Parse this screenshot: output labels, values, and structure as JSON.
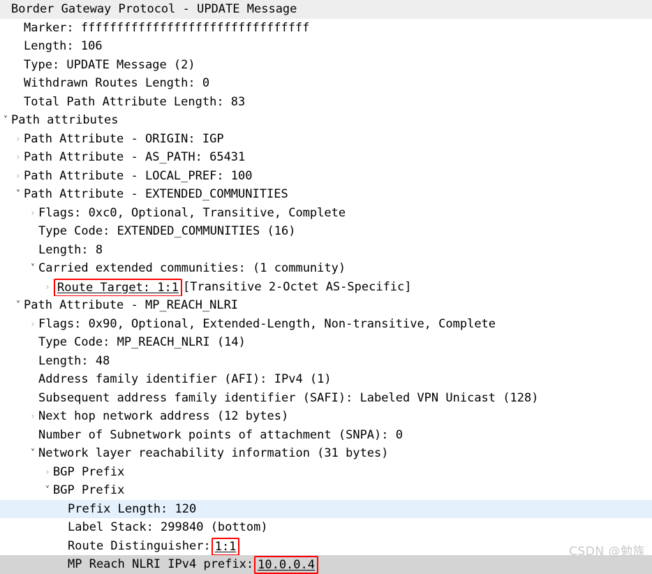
{
  "watermark": "CSDN @勉族",
  "colors": {
    "annotation_box": "#ff0000",
    "selected_row": "#e4f0fb",
    "focused_row": "#d4d4d4",
    "title_row": "#eeeeee",
    "text": "#000000",
    "chevron_collapsed": "#b4b4b4",
    "chevron_expanded": "#2b2b2b"
  },
  "icons": {
    "expanded": "˅",
    "collapsed": "›"
  },
  "tree": [
    {
      "id": "bgp-update-message",
      "indent": 0,
      "toggle": "none",
      "bg": "title",
      "text": "Border Gateway Protocol - UPDATE Message"
    },
    {
      "id": "marker",
      "indent": 1,
      "toggle": "none",
      "bg": "none",
      "text": "Marker: ffffffffffffffffffffffffffffffff"
    },
    {
      "id": "length",
      "indent": 1,
      "toggle": "none",
      "bg": "none",
      "text": "Length: 106"
    },
    {
      "id": "type",
      "indent": 1,
      "toggle": "none",
      "bg": "none",
      "text": "Type: UPDATE Message (2)"
    },
    {
      "id": "withdrawn-routes-length",
      "indent": 1,
      "toggle": "none",
      "bg": "none",
      "text": "Withdrawn Routes Length: 0"
    },
    {
      "id": "total-path-attribute-length",
      "indent": 1,
      "toggle": "none",
      "bg": "none",
      "text": "Total Path Attribute Length: 83"
    },
    {
      "id": "path-attributes",
      "indent": 0,
      "toggle": "expanded",
      "bg": "none",
      "text": "Path attributes"
    },
    {
      "id": "path-attribute-origin",
      "indent": 1,
      "toggle": "collapsed",
      "bg": "none",
      "text": "Path Attribute - ORIGIN: IGP"
    },
    {
      "id": "path-attribute-as-path",
      "indent": 1,
      "toggle": "collapsed",
      "bg": "none",
      "text": "Path Attribute - AS_PATH: 65431"
    },
    {
      "id": "path-attribute-local-pref",
      "indent": 1,
      "toggle": "collapsed",
      "bg": "none",
      "text": "Path Attribute - LOCAL_PREF: 100"
    },
    {
      "id": "path-attribute-extended-communities",
      "indent": 1,
      "toggle": "expanded",
      "bg": "none",
      "text": "Path Attribute - EXTENDED_COMMUNITIES"
    },
    {
      "id": "ext-comm-flags",
      "indent": 2,
      "toggle": "collapsed",
      "bg": "none",
      "text": "Flags: 0xc0, Optional, Transitive, Complete"
    },
    {
      "id": "ext-comm-type-code",
      "indent": 2,
      "toggle": "none",
      "bg": "none",
      "text": "Type Code: EXTENDED_COMMUNITIES (16)"
    },
    {
      "id": "ext-comm-length",
      "indent": 2,
      "toggle": "none",
      "bg": "none",
      "text": "Length: 8"
    },
    {
      "id": "carried-extended-communities",
      "indent": 2,
      "toggle": "expanded",
      "bg": "none",
      "text": "Carried extended communities: (1 community)"
    },
    {
      "id": "route-target",
      "indent": 3,
      "toggle": "collapsed",
      "bg": "none",
      "parts": [
        {
          "style": "boxed-underline",
          "text": "Route Target: 1:1"
        },
        {
          "style": "plain",
          "text": " [Transitive 2-Octet AS-Specific]"
        }
      ]
    },
    {
      "id": "path-attribute-mp-reach-nlri",
      "indent": 1,
      "toggle": "expanded",
      "bg": "none",
      "text": "Path Attribute - MP_REACH_NLRI"
    },
    {
      "id": "mp-reach-flags",
      "indent": 2,
      "toggle": "collapsed",
      "bg": "none",
      "text": "Flags: 0x90, Optional, Extended-Length, Non-transitive, Complete"
    },
    {
      "id": "mp-reach-type-code",
      "indent": 2,
      "toggle": "none",
      "bg": "none",
      "text": "Type Code: MP_REACH_NLRI (14)"
    },
    {
      "id": "mp-reach-length",
      "indent": 2,
      "toggle": "none",
      "bg": "none",
      "text": "Length: 48"
    },
    {
      "id": "address-family-identifier",
      "indent": 2,
      "toggle": "none",
      "bg": "none",
      "text": "Address family identifier (AFI): IPv4 (1)"
    },
    {
      "id": "subsequent-address-family-identifier",
      "indent": 2,
      "toggle": "none",
      "bg": "none",
      "text": "Subsequent address family identifier (SAFI): Labeled VPN Unicast (128)"
    },
    {
      "id": "next-hop-network-address",
      "indent": 2,
      "toggle": "collapsed",
      "bg": "none",
      "text": "Next hop network address (12 bytes)"
    },
    {
      "id": "number-of-snpa",
      "indent": 2,
      "toggle": "none",
      "bg": "none",
      "text": "Number of Subnetwork points of attachment (SNPA): 0"
    },
    {
      "id": "network-layer-reachability-information",
      "indent": 2,
      "toggle": "expanded",
      "bg": "none",
      "text": "Network layer reachability information (31 bytes)"
    },
    {
      "id": "bgp-prefix-1",
      "indent": 3,
      "toggle": "collapsed",
      "bg": "none",
      "text": "BGP Prefix"
    },
    {
      "id": "bgp-prefix-2",
      "indent": 3,
      "toggle": "expanded",
      "bg": "none",
      "text": "BGP Prefix"
    },
    {
      "id": "prefix-length",
      "indent": 4,
      "toggle": "none",
      "bg": "select",
      "text": "Prefix Length: 120"
    },
    {
      "id": "label-stack",
      "indent": 4,
      "toggle": "none",
      "bg": "none",
      "text": "Label Stack: 299840 (bottom)"
    },
    {
      "id": "route-distinguisher",
      "indent": 4,
      "toggle": "none",
      "bg": "none",
      "parts": [
        {
          "style": "plain",
          "text": "Route Distinguisher:"
        },
        {
          "style": "boxed-underline",
          "text": "1:1"
        }
      ]
    },
    {
      "id": "mp-reach-nlri-ipv4-prefix",
      "indent": 4,
      "toggle": "none",
      "bg": "focus",
      "parts": [
        {
          "style": "plain",
          "text": "MP Reach NLRI IPv4 prefix: "
        },
        {
          "style": "boxed-underline",
          "text": "10.0.0.4"
        }
      ]
    }
  ]
}
